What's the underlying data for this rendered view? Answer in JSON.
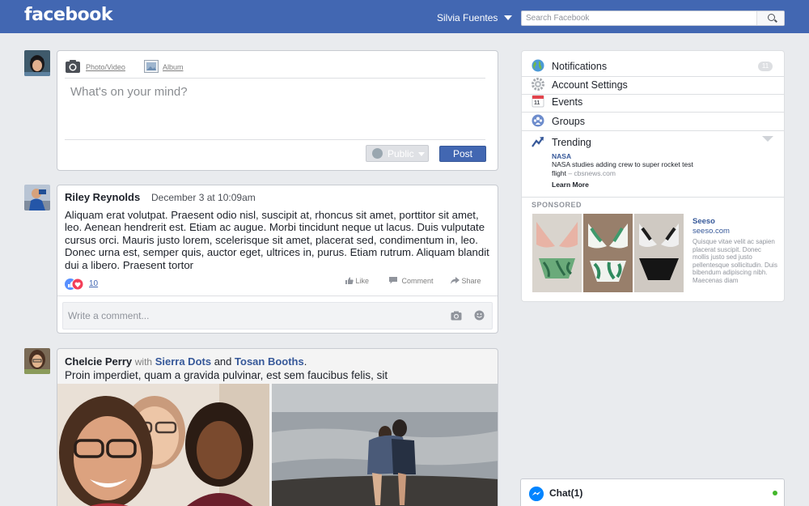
{
  "header": {
    "logo": "facebook",
    "user_name": "Silvia Fuentes",
    "search_placeholder": "Search Facebook",
    "brand_color": "#4267b2"
  },
  "composer": {
    "photo_video": "Photo/Video",
    "album": "Album",
    "placeholder": "What's on your mind?",
    "audience": "Public",
    "post_label": "Post"
  },
  "post1": {
    "author": "Riley Reynolds",
    "date": "December 3 at 10:09am",
    "text": "Aliquam erat volutpat. Praesent odio nisl, suscipit at, rhoncus sit amet, porttitor sit amet, leo. Aenean hendrerit est. Etiam ac augue. Morbi tincidunt neque ut lacus. Duis vulputate cursus orci. Mauris justo lorem, scelerisque sit amet, placerat sed, condimentum in, leo. Donec urna est, semper quis, auctor eget, ultrices in, purus. Etiam rutrum. Aliquam blandit dui a libero. Praesent tortor",
    "reaction_count": "10",
    "like": "Like",
    "comment": "Comment",
    "share": "Share",
    "comment_placeholder": "Write a comment..."
  },
  "post2": {
    "author": "Chelcie Perry",
    "with": "with",
    "tag1": "Sierra Dots",
    "and": "and",
    "tag2": "Tosan Booths",
    "period": ".",
    "text": "Proin imperdiet, quam a gravida pulvinar, est sem faucibus felis, sit"
  },
  "sidebar": {
    "notifications": "Notifications",
    "notifications_count": "11",
    "account_settings": "Account Settings",
    "events": "Events",
    "events_day": "11",
    "groups": "Groups",
    "trending": "Trending",
    "trend_source": "NASA",
    "trend_headline": "NASA studies adding crew to super rocket test flight",
    "trend_domain": "– cbsnews.com",
    "learn_more": "Learn More",
    "sponsored": "SPONSORED",
    "ad_title": "Seeso",
    "ad_url": "seeso.com",
    "ad_text": "Quisque vitae velit ac sapien placerat suscipit. Donec mollis justo sed justo pellentesque sollicitudin. Duis bibendum adipiscing nibh. Maecenas diam"
  },
  "chat": {
    "label": "Chat(1)"
  }
}
